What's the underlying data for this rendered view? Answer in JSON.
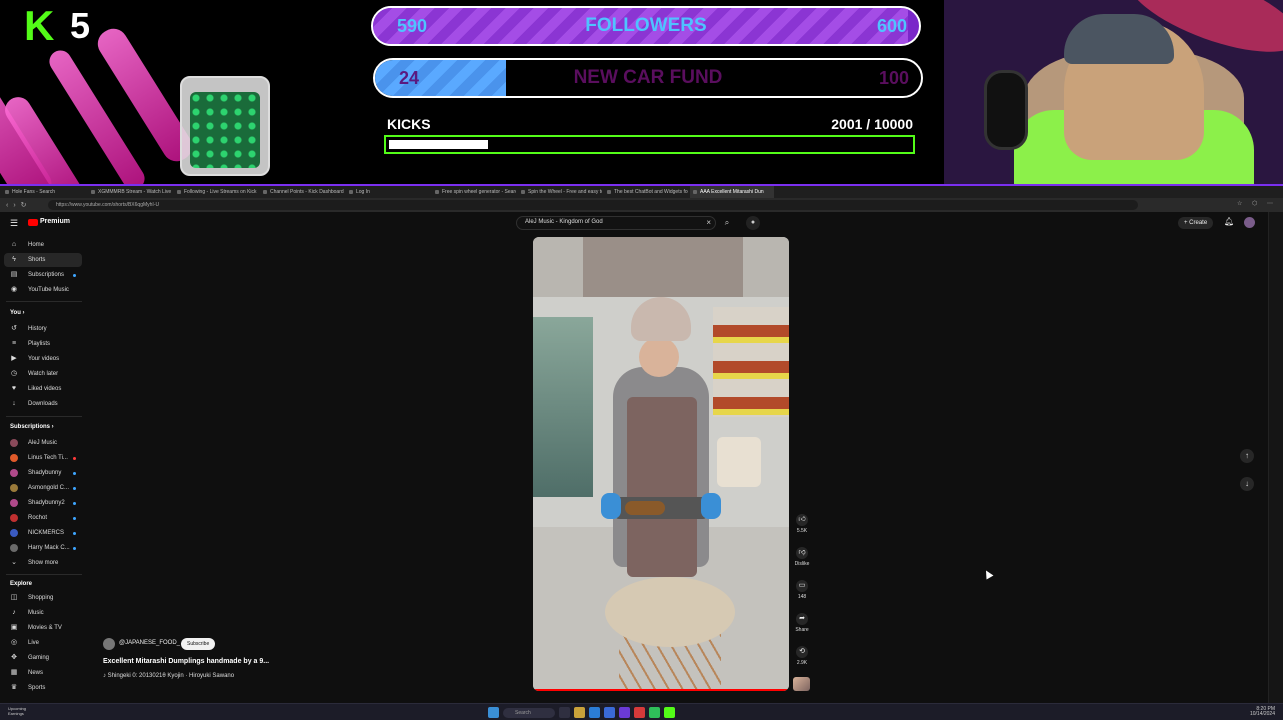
{
  "overlay": {
    "kick_count": "5",
    "kick_logo": "K",
    "followers_goal": {
      "current": "590",
      "label": "FOLLOWERS",
      "target": "600",
      "progress": 0.98
    },
    "car_fund_goal": {
      "current": "24",
      "label": "NEW CAR FUND",
      "target": "100",
      "progress": 0.24
    },
    "kicks_goal": {
      "label": "KICKS",
      "count": "2001  /  10000",
      "progress": 0.2
    }
  },
  "browser": {
    "tabs": [
      "Hole Fans - Search",
      "XGMMMRB Stream - Watch Live",
      "Following - Live Streams on Kick",
      "Channel Points - Kick Dashboard",
      "Log In",
      "Free spin wheel generator - Search",
      "Spin the Wheel - Free and easy to use",
      "The best ChatBot and Widgets for",
      "AAA Excellent Mitarashi Dun"
    ],
    "active_tab_index": 8,
    "url": "https://www.youtube.com/shorts/BX6qgMyhI-U"
  },
  "youtube": {
    "brand": "Premium",
    "search_value": "AleJ Music - Kingdom of God",
    "create_label": "Create",
    "sidebar": {
      "main": [
        {
          "label": "Home",
          "icon": "home-icon"
        },
        {
          "label": "Shorts",
          "icon": "shorts-icon",
          "active": true
        },
        {
          "label": "Subscriptions",
          "icon": "subscriptions-icon",
          "dot": true
        },
        {
          "label": "YouTube Music",
          "icon": "music-icon"
        }
      ],
      "you_header": "You",
      "you": [
        {
          "label": "History",
          "icon": "history-icon"
        },
        {
          "label": "Playlists",
          "icon": "playlists-icon"
        },
        {
          "label": "Your videos",
          "icon": "videos-icon"
        },
        {
          "label": "Watch later",
          "icon": "clock-icon"
        },
        {
          "label": "Liked videos",
          "icon": "like-icon"
        },
        {
          "label": "Downloads",
          "icon": "download-icon"
        }
      ],
      "subs_header": "Subscriptions",
      "subscriptions": [
        {
          "label": "AleJ Music",
          "color": "#8a4a5a"
        },
        {
          "label": "Linus Tech Ti...",
          "color": "#e05a2a",
          "live": true
        },
        {
          "label": "Shadybunny",
          "color": "#b04a8a",
          "dot": true
        },
        {
          "label": "Asmongold C...",
          "color": "#9a7a3a",
          "dot": true
        },
        {
          "label": "Shadybunny2",
          "color": "#b04a8a",
          "dot": true
        },
        {
          "label": "Rochot",
          "color": "#c03030",
          "dot": true
        },
        {
          "label": "NICKMERCS",
          "color": "#3a5ac0",
          "dot": true
        },
        {
          "label": "Harry Mack C...",
          "color": "#6a6a6a",
          "dot": true
        },
        {
          "label": "Show more",
          "chevron": true
        }
      ],
      "explore_header": "Explore",
      "explore": [
        {
          "label": "Shopping",
          "icon": "bag-icon"
        },
        {
          "label": "Music",
          "icon": "music-note-icon"
        },
        {
          "label": "Movies & TV",
          "icon": "film-icon"
        },
        {
          "label": "Live",
          "icon": "live-icon"
        },
        {
          "label": "Gaming",
          "icon": "gaming-icon"
        },
        {
          "label": "News",
          "icon": "news-icon"
        },
        {
          "label": "Sports",
          "icon": "trophy-icon"
        }
      ]
    },
    "short": {
      "channel": "@JAPANESE_FOOD_",
      "subscribe_label": "Subscribe",
      "title": "Excellent Mitarashi Dumplings handmade by a 9...",
      "music": "♪ Shingeki 0: 2013021θ Kyojin · Hiroyuki Sawano",
      "actions": [
        {
          "icon": "like-icon",
          "label": "5.5K"
        },
        {
          "icon": "dislike-icon",
          "label": "Dislike"
        },
        {
          "icon": "comment-icon",
          "label": "148"
        },
        {
          "icon": "share-icon",
          "label": "Share"
        },
        {
          "icon": "remix-icon",
          "label": "2.9K"
        }
      ]
    }
  },
  "taskbar": {
    "weather": "Upcoming",
    "weather_sub": "Earnings",
    "search_placeholder": "Search",
    "time": "8:20 PM",
    "date": "10/14/2024"
  },
  "colors": {
    "kick_green": "#53fc18",
    "goal_purple": "#9b3ddb",
    "goal_blue": "#5aa9ff",
    "yt_red": "#ff0000",
    "accent_border": "#7b2ff0"
  }
}
